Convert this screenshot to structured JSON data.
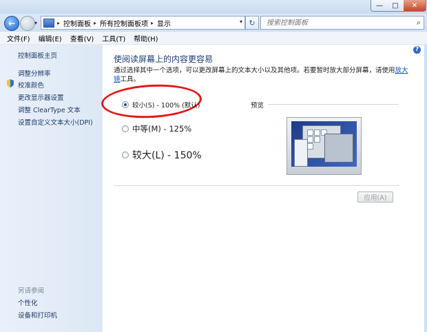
{
  "window": {
    "minimize": "—",
    "maximize": "□",
    "close": "✕"
  },
  "nav": {
    "back": "←",
    "forward": "→",
    "crumbs": [
      "控制面板",
      "所有控制面板项",
      "显示"
    ],
    "search_placeholder": "搜索控制面板"
  },
  "menu": [
    "文件(F)",
    "编辑(E)",
    "查看(V)",
    "工具(T)",
    "帮助(H)"
  ],
  "sidebar": {
    "home": "控制面板主页",
    "links": [
      "调整分辨率",
      "校准颜色",
      "更改显示器设置",
      "调整 ClearType 文本",
      "设置自定义文本大小(DPI)"
    ],
    "see_also_header": "另请参阅",
    "see_also": [
      "个性化",
      "设备和打印机"
    ]
  },
  "main": {
    "heading": "使阅读屏幕上的内容更容易",
    "desc_before_link": "通过选择其中一个选项，可以更改屏幕上的文本大小以及其他项。若要暂时放大部分屏幕，请使用",
    "desc_link": "放大镜",
    "desc_after_link": "工具。",
    "options": [
      {
        "label": "较小(S) - 100% (默认)",
        "checked": true
      },
      {
        "label": "中等(M) - 125%",
        "checked": false
      },
      {
        "label": "较大(L) - 150%",
        "checked": false
      }
    ],
    "preview_label": "预览",
    "apply_label": "应用(A)"
  },
  "icons": {
    "help": "?",
    "search": "⌕",
    "refresh": "↻",
    "dropdown": "▾",
    "crumb_sep": "▸"
  },
  "colors": {
    "accent": "#1e3d78",
    "link": "#0b57c7",
    "annotation": "#e21818"
  }
}
